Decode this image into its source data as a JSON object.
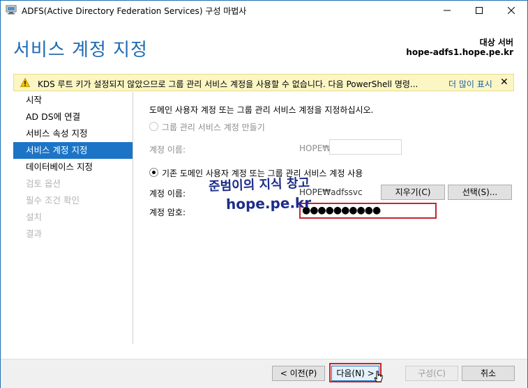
{
  "window": {
    "title": "ADFS(Active Directory Federation Services) 구성 마법사",
    "minimize": "—",
    "maximize": "☐",
    "close": "✕"
  },
  "header": {
    "page_title": "서비스 계정 지정",
    "target_label": "대상 서버",
    "target_server": "hope-adfs1.hope.pe.kr"
  },
  "warning": {
    "text": "KDS 루트 키가 설정되지 않았으므로 그룹 관리 서비스 계정을 사용할 수 없습니다. 다음 PowerShell 명령...",
    "more_link": "더 많이 표시",
    "close": "✕"
  },
  "nav": {
    "items": [
      {
        "label": "시작",
        "state": "normal"
      },
      {
        "label": "AD DS에 연결",
        "state": "normal"
      },
      {
        "label": "서비스 속성 지정",
        "state": "normal"
      },
      {
        "label": "서비스 계정 지정",
        "state": "active"
      },
      {
        "label": "데이터베이스 지정",
        "state": "normal"
      },
      {
        "label": "검토 옵션",
        "state": "disabled"
      },
      {
        "label": "필수 조건 확인",
        "state": "disabled"
      },
      {
        "label": "설치",
        "state": "disabled"
      },
      {
        "label": "결과",
        "state": "disabled"
      }
    ]
  },
  "main": {
    "description": "도메인 사용자 계정 또는 그룹 관리 서비스 계정을 지정하십시오.",
    "option_gmsa": {
      "label": "그룹 관리 서비스 계정 만들기",
      "selected": false,
      "account_label": "계정 이름:",
      "domain_prefix": "HOPE₩",
      "account_value": ""
    },
    "option_existing": {
      "label": "기존 도메인 사용자 계정 또는 그룹 관리 서비스 계정 사용",
      "selected": true,
      "account_label": "계정 이름:",
      "account_value": "HOPE₩adfssvc",
      "clear_button": "지우기(C)",
      "select_button": "선택(S)...",
      "password_label": "계정 암호:",
      "password_value": "●●●●●●●●●●"
    },
    "watermark_line1": "준범이의 지식 창고",
    "watermark_line2": "hope.pe.kr"
  },
  "footer": {
    "prev_button": "< 이전(P)",
    "next_button": "다음(N) >",
    "configure_button": "구성(C)",
    "cancel_button": "취소"
  }
}
